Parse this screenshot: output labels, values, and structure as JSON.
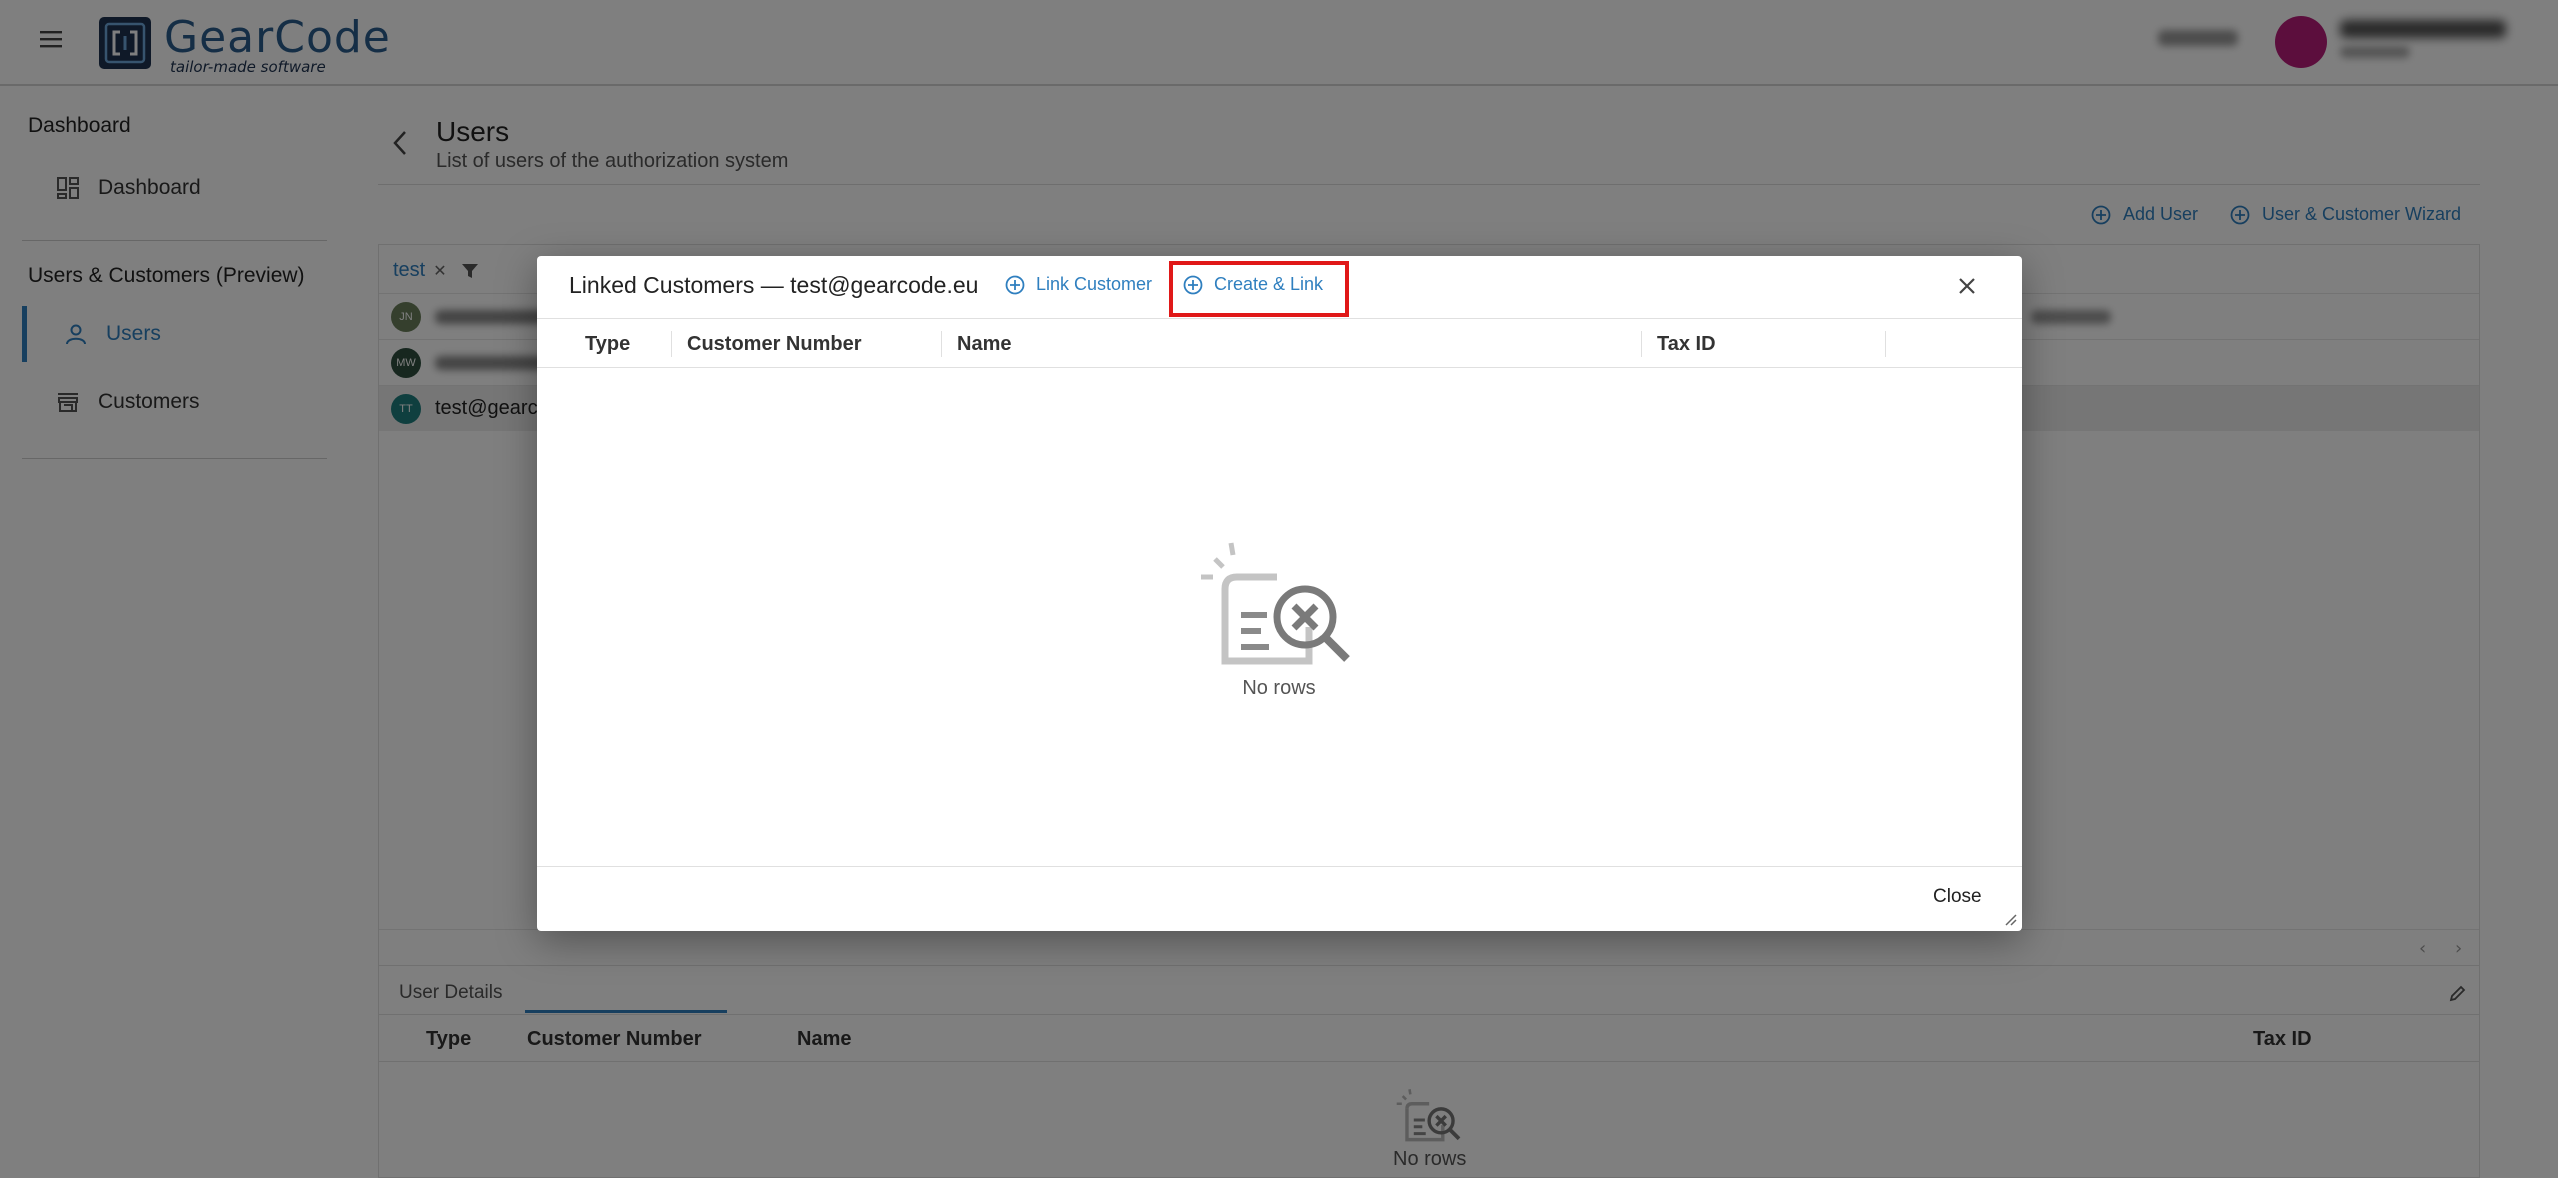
{
  "topbar": {
    "logo_name": "GearCode",
    "logo_tagline": "tailor-made software"
  },
  "sidebar": {
    "sections": [
      {
        "title": "Dashboard",
        "items": [
          {
            "label": "Dashboard",
            "icon": "dashboard-icon"
          }
        ]
      },
      {
        "title": "Users & Customers (Preview)",
        "items": [
          {
            "label": "Users",
            "icon": "person-icon",
            "active": true
          },
          {
            "label": "Customers",
            "icon": "store-icon"
          }
        ]
      }
    ]
  },
  "page": {
    "title": "Users",
    "subtitle": "List of users of the authorization system",
    "actions": {
      "add_user": "Add User",
      "wizard": "User & Customer Wizard"
    }
  },
  "grid": {
    "filter_value": "test",
    "rows": [
      {
        "initials": "JN",
        "color": "#6b7f5a"
      },
      {
        "initials": "MW",
        "color": "#2f4f3f"
      },
      {
        "initials": "TT",
        "color": "#1e7e7e",
        "text": "test@gearc",
        "selected": true
      }
    ]
  },
  "details": {
    "tab_label": "User Details",
    "columns": [
      "Type",
      "Customer Number",
      "Name",
      "Tax ID"
    ],
    "empty_text": "No rows"
  },
  "dialog": {
    "title": "Linked Customers — test@gearcode.eu",
    "link_customer": "Link Customer",
    "create_link": "Create & Link",
    "columns": [
      "Type",
      "Customer Number",
      "Name",
      "Tax ID"
    ],
    "empty_text": "No rows",
    "close_label": "Close",
    "highlight_color": "#e01818",
    "accent_color": "#2f7fbf"
  }
}
